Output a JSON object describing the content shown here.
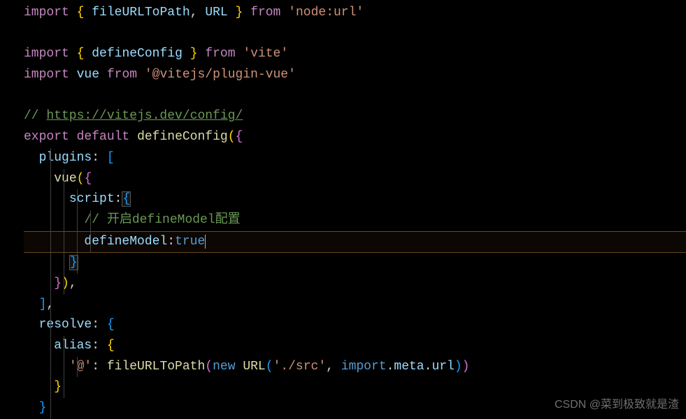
{
  "code": {
    "l1": {
      "import": "import",
      "lb": "{",
      "v1": "fileURLToPath",
      "c": ",",
      "v2": "URL",
      "rb": "}",
      "from": "from",
      "s": "'node:url'"
    },
    "l3": {
      "import": "import",
      "lb": "{",
      "v1": "defineConfig",
      "rb": "}",
      "from": "from",
      "s": "'vite'"
    },
    "l4": {
      "import": "import",
      "v1": "vue",
      "from": "from",
      "s": "'@vitejs/plugin-vue'"
    },
    "l6": {
      "c": "// ",
      "link": "https://vitejs.dev/config/"
    },
    "l7": {
      "export": "export",
      "default": "default",
      "fn": "defineConfig",
      "lp": "(",
      "lb": "{"
    },
    "l8": {
      "key": "plugins",
      "c": ":",
      "lb": "["
    },
    "l9": {
      "fn": "vue",
      "lp": "(",
      "lb": "{"
    },
    "l10": {
      "key": "script",
      "c": ":",
      "lb": "{"
    },
    "l11": {
      "c": "// 开启defineModel配置"
    },
    "l12": {
      "key": "defineModel",
      "c": ":",
      "v": "true"
    },
    "l13": {
      "rb": "}"
    },
    "l14": {
      "rb": "}",
      "rp": ")",
      "c": ","
    },
    "l15": {
      "rb": "]",
      "c": ","
    },
    "l16": {
      "key": "resolve",
      "c": ":",
      "lb": "{"
    },
    "l17": {
      "key": "alias",
      "c": ":",
      "lb": "{"
    },
    "l18": {
      "key": "'@'",
      "c": ":",
      "fn": "fileURLToPath",
      "lp": "(",
      "new": "new",
      "cls": "URL",
      "lp2": "(",
      "s1": "'./src'",
      "cm": ",",
      "imp": "import",
      "dot": ".",
      "meta": "meta",
      "dot2": ".",
      "url": "url",
      "rp2": ")",
      "rp": ")"
    },
    "l19": {
      "rb": "}"
    },
    "l20": {
      "rb": "}"
    }
  },
  "watermark": "CSDN @菜到极致就是渣"
}
